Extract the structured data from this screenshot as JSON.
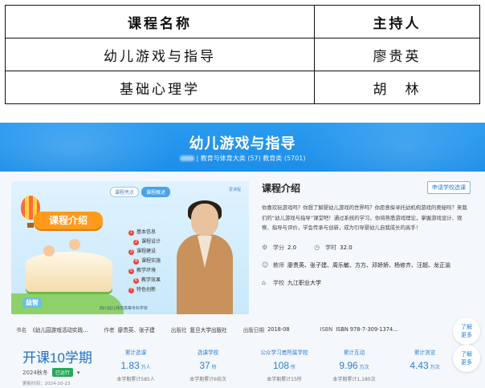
{
  "table": {
    "header": {
      "col1": "课程名称",
      "col2": "主持人"
    },
    "rows": [
      {
        "course": "幼儿游戏与指导",
        "host": "廖贵英"
      },
      {
        "course": "基础心理学",
        "host": "胡　林"
      }
    ]
  },
  "banner": {
    "title": "幼儿游戏与指导",
    "crumbs": "| 教育与体育大类 (57) 教育类 (5701)"
  },
  "media": {
    "tab_highlight": "课程亮点",
    "tab_overview": "课程概述",
    "logo": "爱课程",
    "headline": "课程介绍",
    "menu": [
      {
        "n": "1",
        "label": "基本信息"
      },
      {
        "n": "2",
        "label": "课程设计"
      },
      {
        "n": "3",
        "label": "课程建设"
      },
      {
        "n": "4",
        "label": "课程实施"
      },
      {
        "n": "5",
        "label": "教学环境"
      },
      {
        "n": "6",
        "label": "教学效果"
      },
      {
        "n": "7",
        "label": "特色创新"
      }
    ],
    "stamp": "益智",
    "caption": "四川幼儿师范高等专科学校"
  },
  "info": {
    "title": "课程介绍",
    "apply_button": "申请学校选课",
    "description": "你喜欢玩游戏吗？你想了解婴幼儿游戏的世界吗？你愿意探寻托幼机构游戏的奥秘吗？来我们的“幼儿游戏与指导”课堂吧！通过系统的学习，你将熟悉游戏理论，掌握游戏设计、观察、指导与评价，学会传承与创新，成为引导婴幼儿自我成长的高手！",
    "credit_label": "学分",
    "credit_value": "2.0",
    "hours_label": "学时",
    "hours_value": "32.0",
    "teachers_label": "教师",
    "teachers_value": "廖贵英、张子建、周乐敏、方方、邓娇娇、杨修齐、汪超、龙正渝",
    "school_label": "学校",
    "school_value": "九江职业大学"
  },
  "book": {
    "name_label": "书名",
    "name_value": "《幼儿园游戏活动实践...",
    "author_label": "作者",
    "author_value": "廖贵英、张子建",
    "publisher_label": "出版社",
    "publisher_value": "复旦大学出版社",
    "date_label": "出版日期",
    "date_value": "2018-08",
    "isbn_label": "ISBN",
    "isbn_value": "ISBN 978-7-309-1374..."
  },
  "more_button": {
    "line1": "了解",
    "line2": "更多"
  },
  "stats": {
    "term_title": "开课10学期",
    "term_season": "2024秋冬",
    "term_status": "已运行",
    "term_update_label": "更新时间：",
    "term_update_date": "2024-10-23",
    "items": [
      {
        "label": "累计选课",
        "value": "1.83",
        "unit": "万人",
        "sub": "本学期累计585人"
      },
      {
        "label": "选课学校",
        "value": "37",
        "unit": "所",
        "sub": "本学期累计6校次"
      },
      {
        "label": "公众学习者所属学校",
        "value": "108",
        "unit": "所",
        "sub": "本学期累计15所"
      },
      {
        "label": "累计互动",
        "value": "9.96",
        "unit": "万次",
        "sub": "本学期累计1,180次"
      },
      {
        "label": "累计浏览",
        "value": "4.43",
        "unit": "万次",
        "sub": ""
      }
    ]
  },
  "colors": {
    "banner": "#1d8ee8",
    "accent": "#2a7fd6",
    "status": "#23a85a"
  }
}
